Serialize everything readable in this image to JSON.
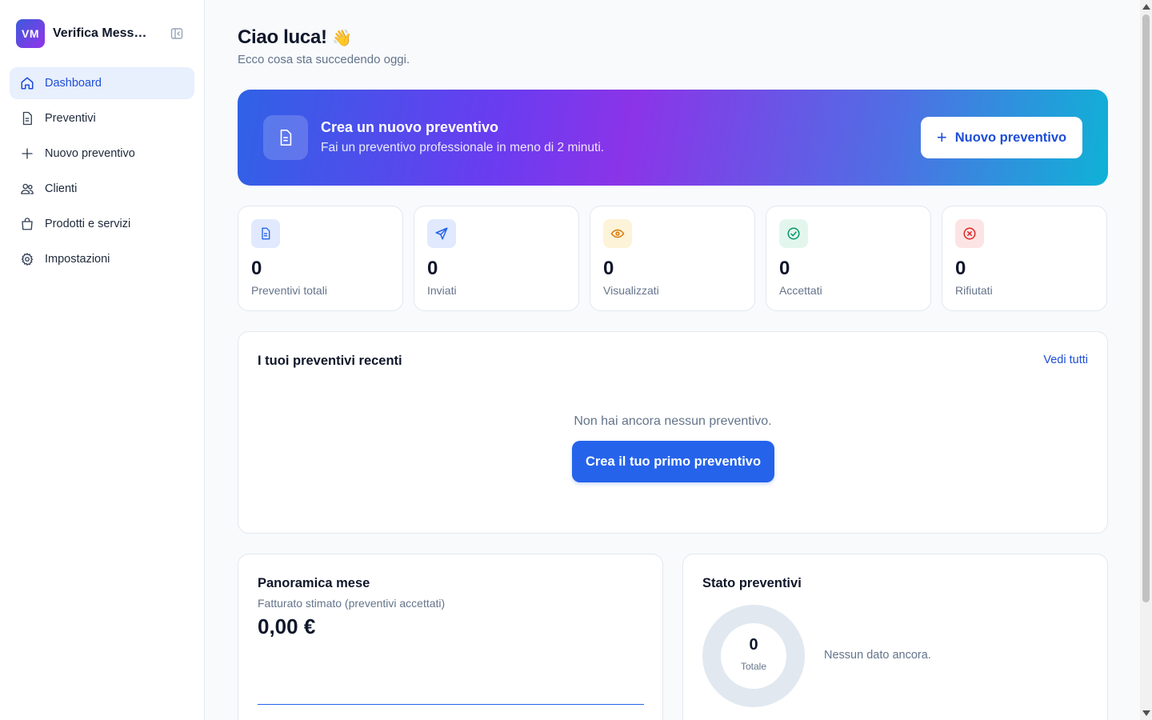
{
  "brand": {
    "logo": "VM",
    "name": "Verifica Messaggi"
  },
  "sidebar": {
    "items": [
      {
        "label": "Dashboard",
        "icon": "home-icon",
        "active": true
      },
      {
        "label": "Preventivi",
        "icon": "document-icon"
      },
      {
        "label": "Nuovo preventivo",
        "icon": "plus-icon"
      },
      {
        "label": "Clienti",
        "icon": "users-icon"
      },
      {
        "label": "Prodotti e servizi",
        "icon": "shopping-bag-icon"
      },
      {
        "label": "Impostazioni",
        "icon": "gear-icon"
      }
    ]
  },
  "header": {
    "greeting": "Ciao luca!",
    "emoji": "👋",
    "subtitle": "Ecco cosa sta succedendo oggi."
  },
  "hero": {
    "title": "Crea un nuovo preventivo",
    "description": "Fai un preventivo professionale in meno di 2 minuti.",
    "button_label": "Nuovo preventivo"
  },
  "stats": [
    {
      "value": "0",
      "label": "Preventivi totali",
      "icon": "document-icon",
      "color": "#2563eb",
      "bg": "#e0e9fd"
    },
    {
      "value": "0",
      "label": "Inviati",
      "icon": "send-icon",
      "color": "#2563eb",
      "bg": "#e0e9fd"
    },
    {
      "value": "0",
      "label": "Visualizzati",
      "icon": "eye-icon",
      "color": "#d97706",
      "bg": "#fdf3d8"
    },
    {
      "value": "0",
      "label": "Accettati",
      "icon": "check-circle-icon",
      "color": "#059669",
      "bg": "#e3f6ee"
    },
    {
      "value": "0",
      "label": "Rifiutati",
      "icon": "x-circle-icon",
      "color": "#dc2626",
      "bg": "#fde4e4"
    }
  ],
  "recent": {
    "title": "I tuoi preventivi recenti",
    "see_all": "Vedi tutti",
    "empty_text": "Non hai ancora nessun preventivo.",
    "cta": "Crea il tuo primo preventivo"
  },
  "month": {
    "title": "Panoramica mese",
    "subtitle": "Fatturato stimato (preventivi accettati)",
    "value": "0,00 €"
  },
  "status": {
    "title": "Stato preventivi",
    "total_value": "0",
    "total_label": "Totale",
    "empty_text": "Nessun dato ancora."
  }
}
